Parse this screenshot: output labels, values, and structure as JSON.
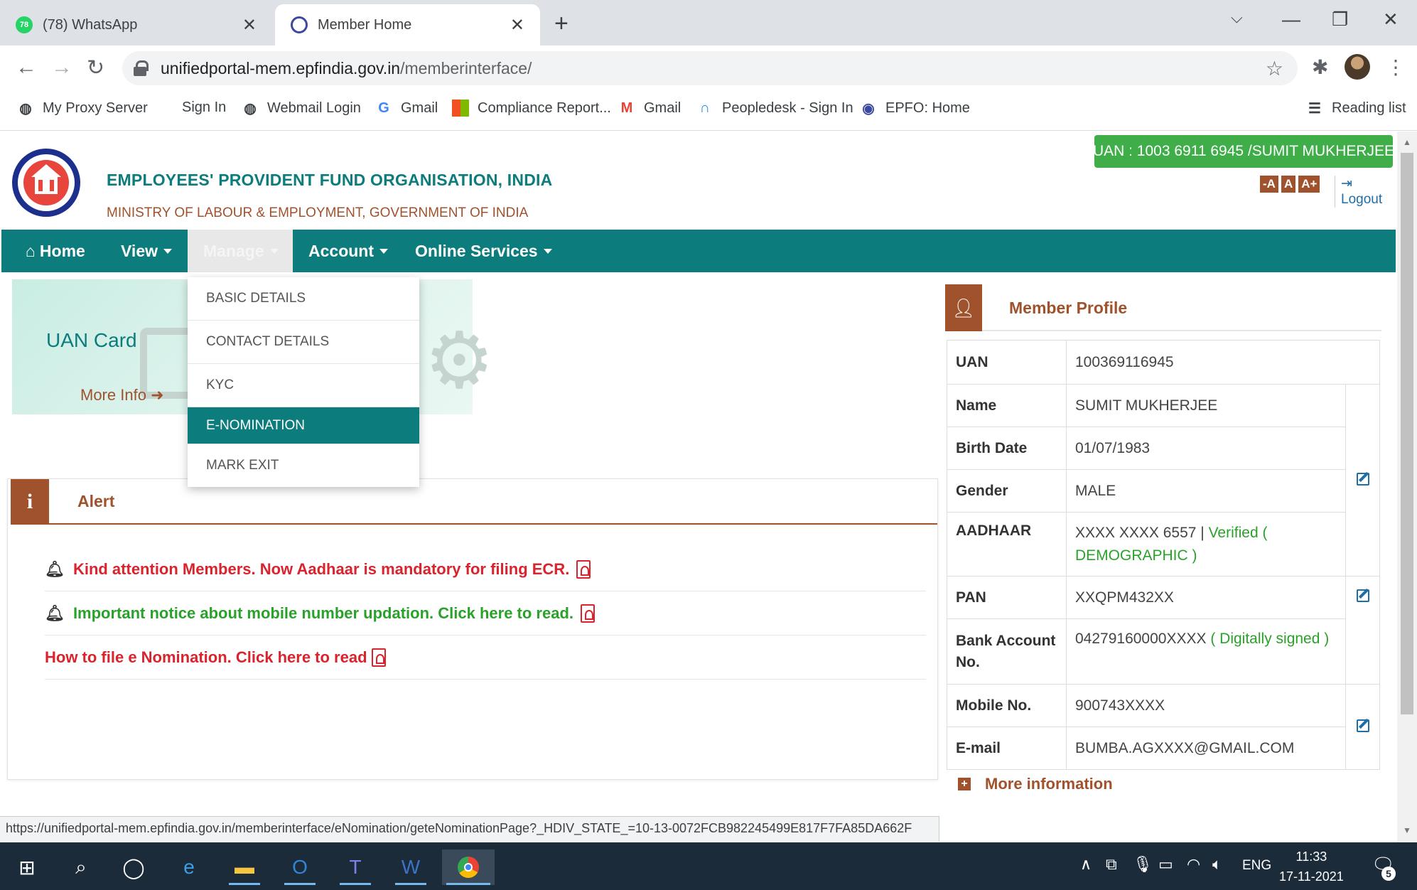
{
  "browser": {
    "tabs": [
      {
        "title": "(78) WhatsApp",
        "badge": "78",
        "active": false
      },
      {
        "title": "Member Home",
        "active": true
      }
    ],
    "url_host": "unifiedportal-mem.epfindia.gov.in",
    "url_path": "/memberinterface/",
    "bookmarks": [
      "My Proxy Server",
      "Sign In",
      "Webmail Login",
      "Gmail",
      "Compliance Report...",
      "Gmail",
      "Peopledesk - Sign In",
      "EPFO: Home"
    ],
    "reading_list": "Reading list",
    "status_url": "https://unifiedportal-mem.epfindia.gov.in/memberinterface/eNomination/geteNominationPage?_HDIV_STATE_=10-13-0072FCB982245499E817F7FA85DA662F"
  },
  "header": {
    "org_name": "EMPLOYEES' PROVIDENT FUND ORGANISATION, INDIA",
    "ministry": "MINISTRY OF LABOUR & EMPLOYMENT, GOVERNMENT OF INDIA",
    "uan_banner": "UAN : 1003 6911 6945 /SUMIT MUKHERJEE",
    "font_buttons": [
      "-A",
      "A",
      "A+"
    ],
    "logout": "Logout"
  },
  "nav": {
    "home": "Home",
    "view": "View",
    "manage": "Manage",
    "account": "Account",
    "online_services": "Online Services"
  },
  "manage_menu": [
    "BASIC DETAILS",
    "CONTACT DETAILS",
    "KYC",
    "E-NOMINATION",
    "MARK EXIT"
  ],
  "uan_card": {
    "label": "UAN Card",
    "more_info": "More Info"
  },
  "alert": {
    "title": "Alert",
    "items": [
      "Kind attention Members. Now Aadhaar is mandatory for filing ECR.",
      "Important notice about mobile number updation. Click here to read.",
      "How to file e Nomination. Click here to read"
    ]
  },
  "profile": {
    "title": "Member Profile",
    "rows": {
      "uan": {
        "label": "UAN",
        "value": "100369116945"
      },
      "name": {
        "label": "Name",
        "value": "SUMIT MUKHERJEE"
      },
      "birth": {
        "label": "Birth Date",
        "value": "01/07/1983"
      },
      "gender": {
        "label": "Gender",
        "value": "MALE"
      },
      "aadhaar": {
        "label": "AADHAAR",
        "value": "XXXX XXXX 6557",
        "status": "Verified ( DEMOGRAPHIC )"
      },
      "pan": {
        "label": "PAN",
        "value": "XXQPM432XX"
      },
      "bank": {
        "label": "Bank Account No.",
        "value": "04279160000XXXX",
        "status": "( Digitally signed )"
      },
      "mobile": {
        "label": "Mobile No.",
        "value": "900743XXXX"
      },
      "email": {
        "label": "E-mail",
        "value": "BUMBA.AGXXXX@GMAIL.COM"
      }
    },
    "more_information": "More information"
  },
  "taskbar": {
    "language": "ENG",
    "time": "11:33",
    "date": "17-11-2021",
    "notifications": "5"
  },
  "colors": {
    "teal": "#0c7c7c",
    "brown": "#a0522d",
    "green": "#3fae49",
    "alert_red": "#d9232d"
  }
}
